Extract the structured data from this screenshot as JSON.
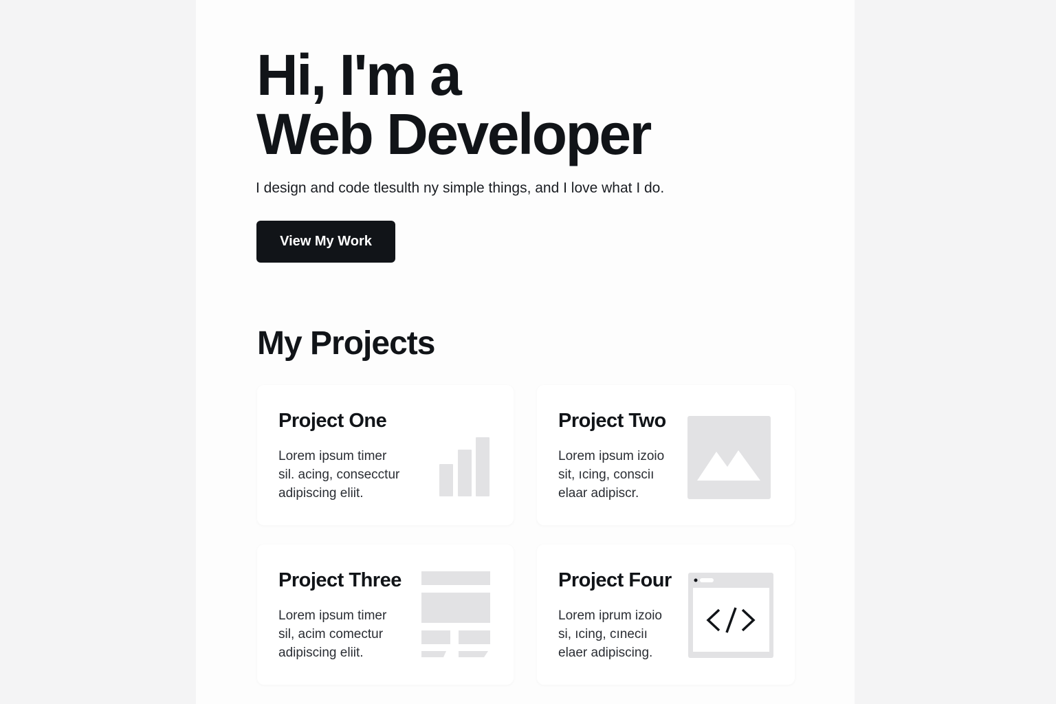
{
  "hero": {
    "title_line1": "Hi, I'm a",
    "title_line2": "Web Developer",
    "subtitle": "I design and code tlesulth ny simple things, and I love what I do.",
    "cta_label": "View My Work"
  },
  "projects_section": {
    "title": "My Projects",
    "cards": [
      {
        "title": "Project One",
        "desc_lines": [
          "Lorem ipsum timer",
          "sil. acing, consecctur",
          "adipiscing eliit."
        ],
        "icon": "bar-chart-icon"
      },
      {
        "title": "Project Two",
        "desc_lines": [
          "Lorem ipsum izoio",
          "sit, ıcing, consciı",
          "elaar adipiscr."
        ],
        "icon": "image-placeholder-icon"
      },
      {
        "title": "Project Three",
        "desc_lines": [
          "Lorem ipsum timer",
          "sil, acim comectur",
          "adipiscing eliit."
        ],
        "icon": "layout-grid-icon"
      },
      {
        "title": "Project Four",
        "desc_lines": [
          "Lorem iprum izoio",
          "si, ıcing, cıneciı",
          "elaer adipiscing."
        ],
        "icon": "code-window-icon"
      }
    ]
  },
  "colors": {
    "background": "#f4f4f5",
    "page": "#fdfdfd",
    "text": "#111418",
    "button": "#111418",
    "placeholder": "#e2e2e4"
  }
}
